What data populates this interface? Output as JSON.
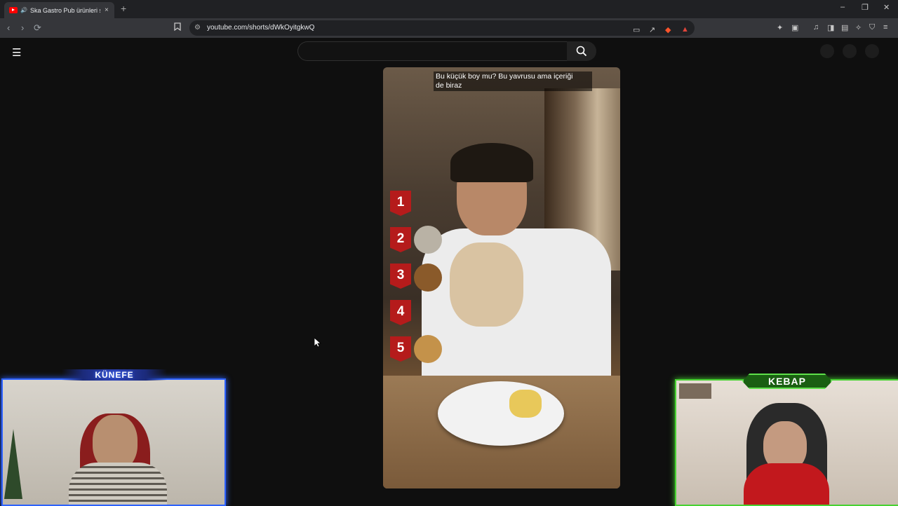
{
  "browser": {
    "tab_title": "Ska Gastro Pub ürünleri sıralı",
    "tab_close": "×",
    "new_tab": "+",
    "url": "youtube.com/shorts/dWkOyitgkwQ",
    "window_controls": [
      "–",
      "❐",
      "✕"
    ]
  },
  "youtube": {
    "search_placeholder": ""
  },
  "video": {
    "caption_lines": [
      "Bu küçük boy mu? Bu yavrusu ama içeriği",
      "de biraz"
    ],
    "ranks": [
      "1",
      "2",
      "3",
      "4",
      "5"
    ]
  },
  "overlays": {
    "left_label": "KÜNEFE",
    "right_label": "KEBAP"
  }
}
